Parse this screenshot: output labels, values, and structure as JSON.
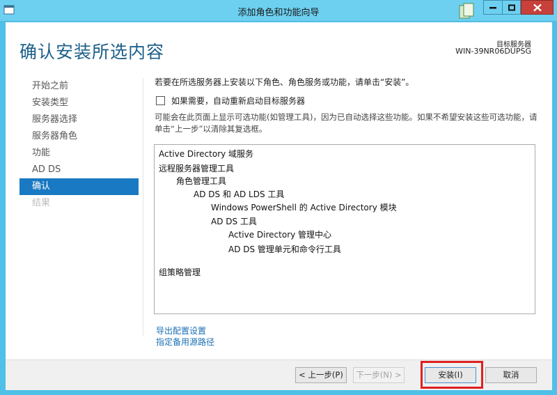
{
  "window": {
    "title": "添加角色和功能向导"
  },
  "header": {
    "page_title": "确认安装所选内容",
    "target_label": "目标服务器",
    "target_name": "WIN-39NR06DUPSG"
  },
  "nav": {
    "items": [
      {
        "label": "开始之前",
        "state": "normal"
      },
      {
        "label": "安装类型",
        "state": "normal"
      },
      {
        "label": "服务器选择",
        "state": "normal"
      },
      {
        "label": "服务器角色",
        "state": "normal"
      },
      {
        "label": "功能",
        "state": "normal"
      },
      {
        "label": "AD DS",
        "state": "normal"
      },
      {
        "label": "确认",
        "state": "active"
      },
      {
        "label": "结果",
        "state": "disabled"
      }
    ]
  },
  "main": {
    "instruction": "若要在所选服务器上安装以下角色、角色服务或功能，请单击“安装”。",
    "restart_checkbox": {
      "label": "如果需要，自动重新启动目标服务器",
      "checked": false
    },
    "optional_note": "可能会在此页面上显示可选功能(如管理工具)，因为已自动选择这些功能。如果不希望安装这些可选功能，请单击“上一步”以清除其复选框。",
    "features": [
      {
        "label": "Active Directory 域服务",
        "level": 0
      },
      {
        "label": "远程服务器管理工具",
        "level": 0
      },
      {
        "label": "角色管理工具",
        "level": 1
      },
      {
        "label": "AD DS 和 AD LDS 工具",
        "level": 2
      },
      {
        "label": "Windows PowerShell 的 Active Directory 模块",
        "level": 3
      },
      {
        "label": "AD DS 工具",
        "level": 3
      },
      {
        "label": "Active Directory 管理中心",
        "level": 4
      },
      {
        "label": "AD DS 管理单元和命令行工具",
        "level": 4
      },
      {
        "label": "组策略管理",
        "level": 0
      }
    ],
    "links": {
      "export": "导出配置设置",
      "alternate_source": "指定备用源路径"
    }
  },
  "buttons": {
    "previous": "< 上一步(P)",
    "next": "下一步(N) >",
    "install": "安装(I)",
    "cancel": "取消"
  },
  "colors": {
    "title_bar": "#6dd0f0",
    "accent": "#1979c2",
    "link": "#1b6fb5",
    "highlight": "#e02020"
  }
}
